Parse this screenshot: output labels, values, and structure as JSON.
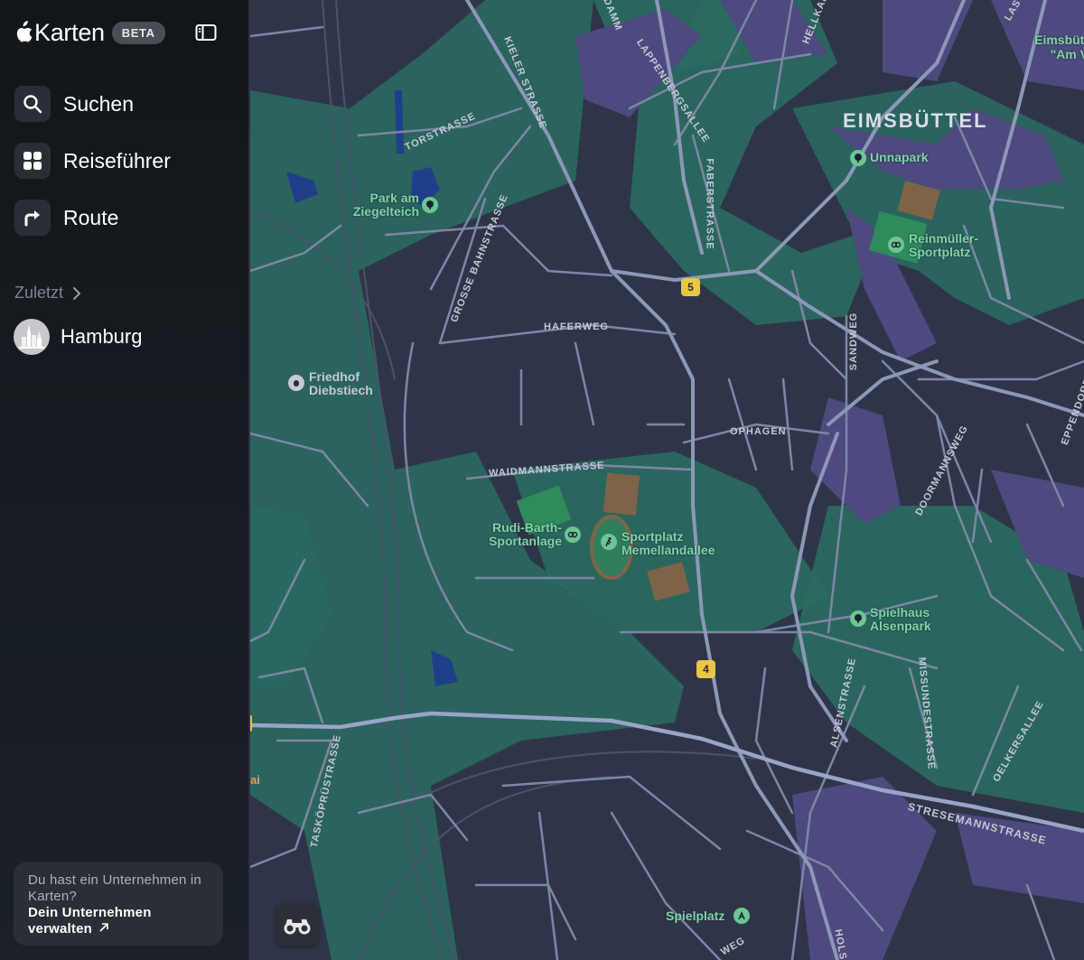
{
  "app": {
    "name": "Karten",
    "badge": "BETA"
  },
  "nav": [
    {
      "id": "search",
      "label": "Suchen",
      "icon": "search-icon"
    },
    {
      "id": "guides",
      "label": "Reiseführer",
      "icon": "grid-icon"
    },
    {
      "id": "route",
      "label": "Route",
      "icon": "route-arrow-icon"
    }
  ],
  "recents": {
    "header": "Zuletzt",
    "items": [
      {
        "label": "Hamburg",
        "icon": "city-skyline-icon"
      }
    ]
  },
  "business_card": {
    "question": "Du hast ein Unternehmen in Karten?",
    "link": "Dein Unternehmen verwalten",
    "link_icon": "external-arrow-icon"
  },
  "map": {
    "district": "EIMSBÜTTEL",
    "district_partial": "Eimsbütt \"Am V",
    "streets": {
      "kieler": "KIELER STRASSE",
      "torstrasse": "TORSTRASSE",
      "grosse_bahn": "GROSSE BAHNSTRASSE",
      "haferweg": "HAFERWEG",
      "waidmann": "WAIDMANNSTRASSE",
      "ophagen": "OPHAGEN",
      "lappenberg": "LAPPENBERGSALLEE",
      "faber": "FABERSTRASSE",
      "sandweg": "SANDWEG",
      "doormann": "DOORMANNSWEG",
      "eppendorf": "EPPENDORF",
      "alsen": "ALSENSTRASSE",
      "missunde": "MISSUNDESTRASSE",
      "oelker": "OELKERSALLEE",
      "stresemann": "STRESEMANNSTRASSE",
      "taskoepru": "TASKÖPRÜSTRASSE",
      "damm": "DAMM",
      "hellkamp": "HELLKAM",
      "lasto": "LAST",
      "holst": "HOLS",
      "weg": "WEG"
    },
    "pois": {
      "park_ziegelteich": "Park am Ziegelteich",
      "friedhof": "Friedhof Diebstiech",
      "rudi_barth": "Rudi-Barth- Sportanlage",
      "sportplatz_memelland": "Sportplatz Memellandallee",
      "unnapark": "Unnapark",
      "reinmueller": "Reinmüller- Sportplatz",
      "spielhaus": "Spielhaus Alsenpark",
      "spielplatz": "Spielplatz"
    },
    "shields": {
      "s5": "5",
      "s4": "4"
    },
    "edge_fragment": "ai",
    "colors": {
      "base": "#2f3549",
      "green": "#2a6b61",
      "purple": "#4c4a7e",
      "road": "#8d97b8",
      "poi_green": "#7fd6a6",
      "shield": "#e9c646"
    }
  }
}
